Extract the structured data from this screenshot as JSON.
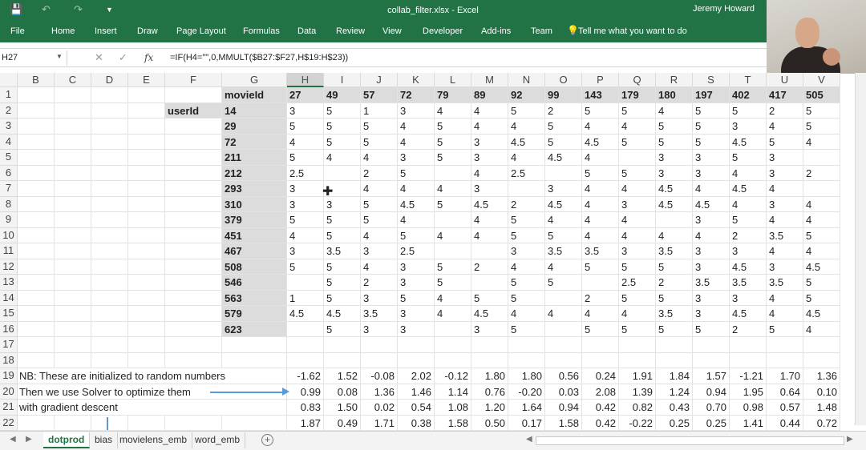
{
  "titlebar": {
    "doc_title": "collab_filter.xlsx  -  Excel",
    "user": "Jeremy Howard",
    "save_icon": "save-icon",
    "undo_icon": "undo-icon",
    "redo_icon": "redo-icon",
    "customize_icon": "customize-quick-access-icon"
  },
  "ribbon": {
    "tabs": [
      "File",
      "Home",
      "Insert",
      "Draw",
      "Page Layout",
      "Formulas",
      "Data",
      "Review",
      "View",
      "Developer",
      "Add-ins",
      "Team"
    ],
    "tell_me": "Tell me what you want to do",
    "tell_me_icon": "lightbulb-icon"
  },
  "formula_bar": {
    "name_box": "H27",
    "formula": "=IF(H4=\"\",0,MMULT($B27:$F27,H$19:H$23))"
  },
  "columns": [
    "B",
    "C",
    "D",
    "E",
    "F",
    "G",
    "H",
    "I",
    "J",
    "K",
    "L",
    "M",
    "N",
    "O",
    "P",
    "Q",
    "R",
    "S",
    "T",
    "U",
    "V"
  ],
  "rows": [
    "1",
    "2",
    "3",
    "4",
    "5",
    "6",
    "7",
    "8",
    "9",
    "10",
    "11",
    "12",
    "13",
    "14",
    "15",
    "16",
    "17",
    "18",
    "19",
    "20",
    "21",
    "22"
  ],
  "labels": {
    "movie_id": "movieId",
    "user_id": "userId"
  },
  "movie_ids": [
    "27",
    "49",
    "57",
    "72",
    "79",
    "89",
    "92",
    "99",
    "143",
    "179",
    "180",
    "197",
    "402",
    "417",
    "505"
  ],
  "user_ids": [
    "14",
    "29",
    "72",
    "211",
    "212",
    "293",
    "310",
    "379",
    "451",
    "467",
    "508",
    "546",
    "563",
    "579",
    "623"
  ],
  "ratings": [
    [
      "3",
      "5",
      "1",
      "3",
      "4",
      "4",
      "5",
      "2",
      "5",
      "5",
      "4",
      "5",
      "5",
      "2",
      "5"
    ],
    [
      "5",
      "5",
      "5",
      "4",
      "5",
      "4",
      "4",
      "5",
      "4",
      "4",
      "5",
      "5",
      "3",
      "4",
      "5"
    ],
    [
      "4",
      "5",
      "5",
      "4",
      "5",
      "3",
      "4.5",
      "5",
      "4.5",
      "5",
      "5",
      "5",
      "4.5",
      "5",
      "4"
    ],
    [
      "5",
      "4",
      "4",
      "3",
      "5",
      "3",
      "4",
      "4.5",
      "4",
      "",
      "3",
      "3",
      "5",
      "3",
      ""
    ],
    [
      "2.5",
      "",
      "2",
      "5",
      "",
      "4",
      "2.5",
      "",
      "5",
      "5",
      "3",
      "3",
      "4",
      "3",
      "2"
    ],
    [
      "3",
      "",
      "4",
      "4",
      "4",
      "3",
      "",
      "3",
      "4",
      "4",
      "4.5",
      "4",
      "4.5",
      "4",
      ""
    ],
    [
      "3",
      "3",
      "5",
      "4.5",
      "5",
      "4.5",
      "2",
      "4.5",
      "4",
      "3",
      "4.5",
      "4.5",
      "4",
      "3",
      "4"
    ],
    [
      "5",
      "5",
      "5",
      "4",
      "",
      "4",
      "5",
      "4",
      "4",
      "4",
      "",
      "3",
      "5",
      "4",
      "4"
    ],
    [
      "4",
      "5",
      "4",
      "5",
      "4",
      "4",
      "5",
      "5",
      "4",
      "4",
      "4",
      "4",
      "2",
      "3.5",
      "5"
    ],
    [
      "3",
      "3.5",
      "3",
      "2.5",
      "",
      "",
      "3",
      "3.5",
      "3.5",
      "3",
      "3.5",
      "3",
      "3",
      "4",
      "4"
    ],
    [
      "5",
      "5",
      "4",
      "3",
      "5",
      "2",
      "4",
      "4",
      "5",
      "5",
      "5",
      "3",
      "4.5",
      "3",
      "4.5"
    ],
    [
      "",
      "5",
      "2",
      "3",
      "5",
      "",
      "5",
      "5",
      "",
      "2.5",
      "2",
      "3.5",
      "3.5",
      "3.5",
      "5"
    ],
    [
      "1",
      "5",
      "3",
      "5",
      "4",
      "5",
      "5",
      "",
      "2",
      "5",
      "5",
      "3",
      "3",
      "4",
      "5"
    ],
    [
      "4.5",
      "4.5",
      "3.5",
      "3",
      "4",
      "4.5",
      "4",
      "4",
      "4",
      "4",
      "3.5",
      "3",
      "4.5",
      "4",
      "4.5"
    ],
    [
      "",
      "5",
      "3",
      "3",
      "",
      "3",
      "5",
      "",
      "5",
      "5",
      "5",
      "5",
      "2",
      "5",
      "4"
    ]
  ],
  "notes": [
    "NB: These are initialized to random numbers",
    "Then we use Solver to optimize them",
    "with gradient descent"
  ],
  "factors": [
    [
      "-1.62",
      "1.52",
      "-0.08",
      "2.02",
      "-0.12",
      "1.80",
      "1.80",
      "0.56",
      "0.24",
      "1.91",
      "1.84",
      "1.57",
      "-1.21",
      "1.70",
      "1.36"
    ],
    [
      "0.99",
      "0.08",
      "1.36",
      "1.46",
      "1.14",
      "0.76",
      "-0.20",
      "0.03",
      "2.08",
      "1.39",
      "1.24",
      "0.94",
      "1.95",
      "0.64",
      "0.10"
    ],
    [
      "0.83",
      "1.50",
      "0.02",
      "0.54",
      "1.08",
      "1.20",
      "1.64",
      "0.94",
      "0.42",
      "0.82",
      "0.43",
      "0.70",
      "0.98",
      "0.57",
      "1.48"
    ],
    [
      "1.87",
      "0.49",
      "1.71",
      "0.38",
      "1.58",
      "0.50",
      "0.17",
      "1.58",
      "0.42",
      "-0.22",
      "0.25",
      "0.25",
      "1.41",
      "0.44",
      "0.72"
    ]
  ],
  "sheets": [
    "dotprod",
    "bias",
    "movielens_emb",
    "word_emb"
  ],
  "active_sheet": "dotprod",
  "add_sheet_icon": "add-sheet-icon",
  "colors": {
    "accent": "#217346",
    "header_bg": "#f3f3f3",
    "gray_cell": "#dcdcdc",
    "arrow": "#5b9bd5"
  }
}
